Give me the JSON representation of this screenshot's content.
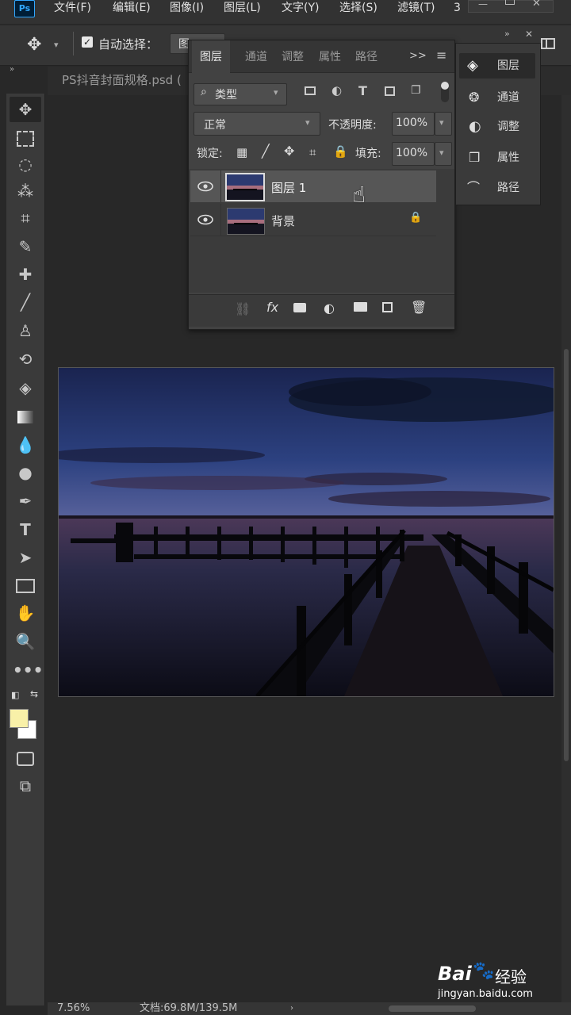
{
  "menu": {
    "logo": "Ps",
    "items": [
      "文件(F)",
      "编辑(E)",
      "图像(I)",
      "图层(L)",
      "文字(Y)",
      "选择(S)",
      "滤镜(T)",
      "3"
    ]
  },
  "options": {
    "auto_select_label": "自动选择：",
    "auto_select_value": "图"
  },
  "document": {
    "tab_title": "PS抖音封面规格.psd ("
  },
  "layers_panel": {
    "tabs": [
      "图层",
      "通道",
      "调整",
      "属性",
      "路径"
    ],
    "filter_label": "类型",
    "blend_mode": "正常",
    "opacity_label": "不透明度:",
    "opacity_value": "100%",
    "lock_label": "锁定:",
    "fill_label": "填充:",
    "fill_value": "100%",
    "layers": [
      {
        "name": "图层 1",
        "visible": true,
        "selected": true,
        "locked": false
      },
      {
        "name": "背景",
        "visible": true,
        "selected": false,
        "locked": true
      }
    ],
    "footer_icons": [
      "link-icon",
      "fx-icon",
      "mask-icon",
      "adjustment-icon",
      "folder-icon",
      "new-layer-icon",
      "trash-icon"
    ],
    "fx_text": "fx"
  },
  "dock": {
    "items": [
      {
        "label": "图层",
        "icon": "layers-icon",
        "active": true
      },
      {
        "label": "通道",
        "icon": "channels-icon",
        "active": false
      },
      {
        "label": "调整",
        "icon": "adjustments-icon",
        "active": false
      },
      {
        "label": "属性",
        "icon": "properties-icon",
        "active": false
      },
      {
        "label": "路径",
        "icon": "paths-icon",
        "active": false
      }
    ]
  },
  "status": {
    "zoom": "7.56%",
    "doc_size": "文档:69.8M/139.5M"
  },
  "watermark": {
    "brand": "Bai",
    "brand2": "经验",
    "url": "jingyan.baidu.com"
  },
  "colors": {
    "foreground": "#f8f0a8",
    "background": "#ffffff",
    "accent": "#31a8ff"
  }
}
